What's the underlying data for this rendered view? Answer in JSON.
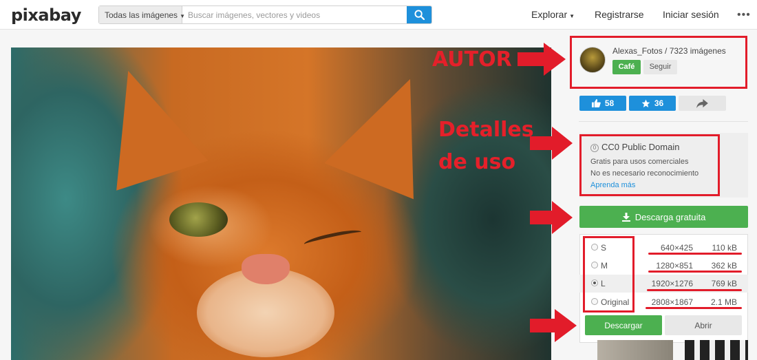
{
  "header": {
    "logo": "pixabay",
    "search_scope": "Todas las imágenes",
    "search_placeholder": "Buscar imágenes, vectores y videos",
    "nav": [
      "Explorar",
      "Registrarse",
      "Iniciar sesión"
    ],
    "more": "•••"
  },
  "annotations": {
    "autor": "AUTOR",
    "detalles_line1": "Detalles",
    "detalles_line2": "de uso",
    "accent_color": "#e21c2a"
  },
  "author": {
    "name_line": "Alexas_Fotos / 7323 imágenes",
    "cafe_label": "Café",
    "follow_label": "Seguir"
  },
  "stats": {
    "likes": "58",
    "favorites": "36"
  },
  "license": {
    "title": "CC0 Public Domain",
    "line1": "Gratis para usos comerciales",
    "line2": "No es necesario reconocimiento",
    "link": "Aprenda más"
  },
  "download": {
    "label": "Descarga gratuita",
    "sizes": [
      {
        "label": "S",
        "dimensions": "640×425",
        "filesize": "110 kB",
        "selected": false
      },
      {
        "label": "M",
        "dimensions": "1280×851",
        "filesize": "362 kB",
        "selected": false
      },
      {
        "label": "L",
        "dimensions": "1920×1276",
        "filesize": "769 kB",
        "selected": true
      },
      {
        "label": "Original",
        "dimensions": "2808×1867",
        "filesize": "2.1 MB",
        "selected": false
      }
    ],
    "download_button": "Descargar",
    "open_button": "Abrir"
  },
  "colors": {
    "primary_blue": "#1e90db",
    "green": "#4cb050"
  }
}
